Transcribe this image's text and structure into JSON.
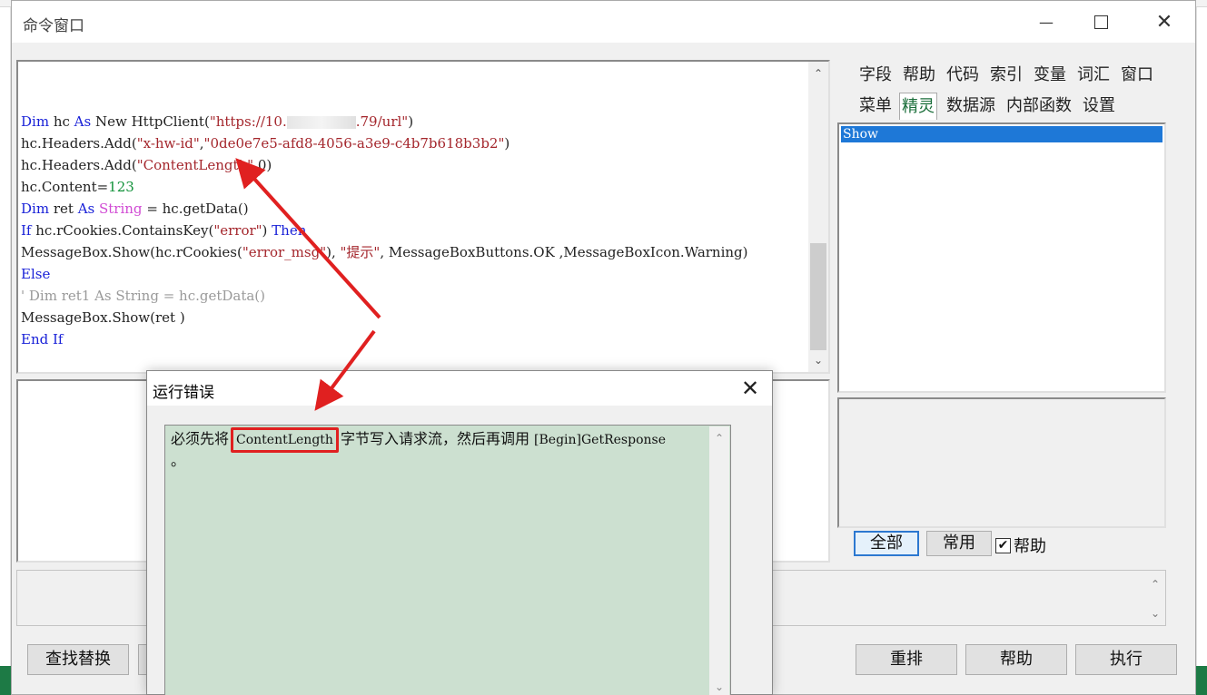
{
  "window": {
    "title": "命令窗口",
    "controls": {
      "minimize": "—",
      "close": "✕"
    }
  },
  "editor": {
    "lines": [
      {
        "segments": [
          {
            "t": "Dim",
            "c": "kw"
          },
          {
            "t": " hc "
          },
          {
            "t": "As",
            "c": "kw"
          },
          {
            "t": " New HttpClient("
          },
          {
            "t": "\"https://10.",
            "c": "str"
          },
          {
            "t": "BLUR",
            "c": "blur"
          },
          {
            "t": ".79/url\"",
            "c": "str"
          },
          {
            "t": ")"
          }
        ]
      },
      {
        "segments": [
          {
            "t": "hc.Headers.Add("
          },
          {
            "t": "\"x-hw-id\"",
            "c": "str"
          },
          {
            "t": ","
          },
          {
            "t": "\"0de0e7e5-afd8-4056-a3e9-c4b7b618b3b2\"",
            "c": "str"
          },
          {
            "t": ")"
          }
        ]
      },
      {
        "segments": [
          {
            "t": "hc.Headers.Add("
          },
          {
            "t": "\"ContentLength\"",
            "c": "str"
          },
          {
            "t": ",0)"
          }
        ]
      },
      {
        "segments": [
          {
            "t": "hc.Content="
          },
          {
            "t": "123",
            "c": "num"
          }
        ]
      },
      {
        "segments": [
          {
            "t": "Dim",
            "c": "kw"
          },
          {
            "t": " ret "
          },
          {
            "t": "As",
            "c": "kw"
          },
          {
            "t": " "
          },
          {
            "t": "String",
            "c": "ty"
          },
          {
            "t": " = hc.getData()"
          }
        ]
      },
      {
        "segments": [
          {
            "t": "If",
            "c": "kw"
          },
          {
            "t": " hc.rCookies.ContainsKey("
          },
          {
            "t": "\"error\"",
            "c": "str"
          },
          {
            "t": ") "
          },
          {
            "t": "Then",
            "c": "kw"
          }
        ]
      },
      {
        "segments": [
          {
            "t": "MessageBox.Show(hc.rCookies("
          },
          {
            "t": "\"error_msg\"",
            "c": "str"
          },
          {
            "t": "), "
          },
          {
            "t": "\"提示\"",
            "c": "str"
          },
          {
            "t": ", MessageBoxButtons.OK ,MessageBoxIcon.Warning)"
          }
        ]
      },
      {
        "segments": [
          {
            "t": "Else",
            "c": "kw"
          }
        ]
      },
      {
        "segments": [
          {
            "t": "' Dim ret1 As String = hc.getData()",
            "c": "cm"
          }
        ]
      },
      {
        "segments": [
          {
            "t": "MessageBox.Show(ret )"
          }
        ]
      },
      {
        "segments": [
          {
            "t": "End If",
            "c": "kw"
          }
        ]
      }
    ]
  },
  "right_panel": {
    "tabs_row1": [
      "字段",
      "帮助",
      "代码",
      "索引",
      "变量",
      "词汇",
      "窗口"
    ],
    "tabs_row2": [
      "菜单",
      "精灵",
      "数据源",
      "内部函数",
      "设置"
    ],
    "active_tab": "精灵",
    "list_items": [
      "Show"
    ],
    "filter_buttons": {
      "all": "全部",
      "common": "常用"
    },
    "help_checkbox": {
      "label": "帮助",
      "checked": true
    }
  },
  "bottom_buttons": {
    "find_replace": "查找替换",
    "rearrange": "重排",
    "help": "帮助",
    "execute": "执行"
  },
  "error_dialog": {
    "title": "运行错误",
    "message_prefix": "必须先将",
    "message_highlight": "ContentLength",
    "message_middle": "字节写入请求流，然后再调用",
    "message_code": "[Begin]GetResponse",
    "message_suffix": "。"
  },
  "colors": {
    "annotation": "#e02020",
    "dialog_message_bg": "#cce0d0",
    "selection": "#1e78d7",
    "taskbar": "#1d7a45"
  }
}
